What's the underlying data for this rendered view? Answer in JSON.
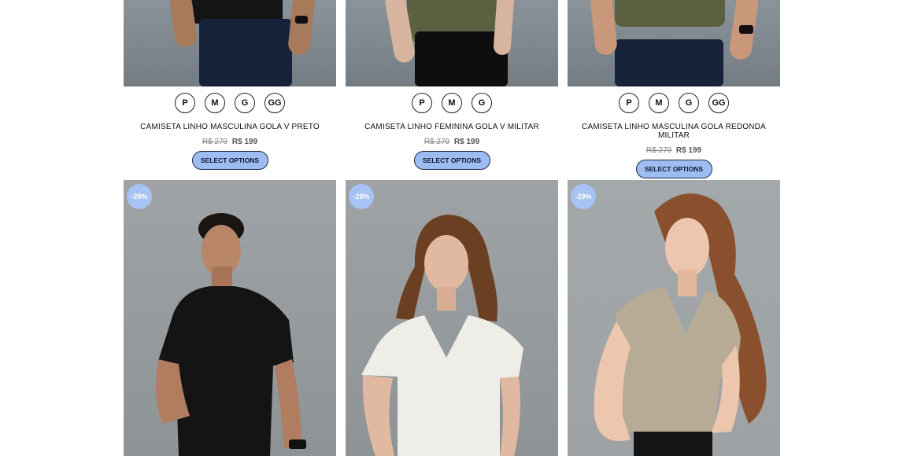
{
  "top_products": [
    {
      "sizes": [
        "P",
        "M",
        "G",
        "GG"
      ],
      "title": "CAMISETA LINHO MASCULINA GOLA V PRETO",
      "old_price": "R$ 279",
      "new_price": "R$ 199",
      "button": "SELECT OPTIONS"
    },
    {
      "sizes": [
        "P",
        "M",
        "G"
      ],
      "title": "CAMISETA LINHO FEMININA GOLA V MILITAR",
      "old_price": "R$ 279",
      "new_price": "R$ 199",
      "button": "SELECT OPTIONS"
    },
    {
      "sizes": [
        "P",
        "M",
        "G",
        "GG"
      ],
      "title": "CAMISETA LINHO MASCULINA GOLA REDONDA MILITAR",
      "old_price": "R$ 279",
      "new_price": "R$ 199",
      "button": "SELECT OPTIONS"
    }
  ],
  "bottom_products": [
    {
      "badge": "-29%"
    },
    {
      "badge": "-29%"
    },
    {
      "badge": "-29%"
    }
  ],
  "colors": {
    "button_bg": "#9dbdf2",
    "badge_bg": "#a6c3f4",
    "shirt_black": "#141414",
    "shirt_olive": "#5a6040",
    "shirt_white": "#efede8",
    "shirt_beige": "#b8ab96"
  }
}
